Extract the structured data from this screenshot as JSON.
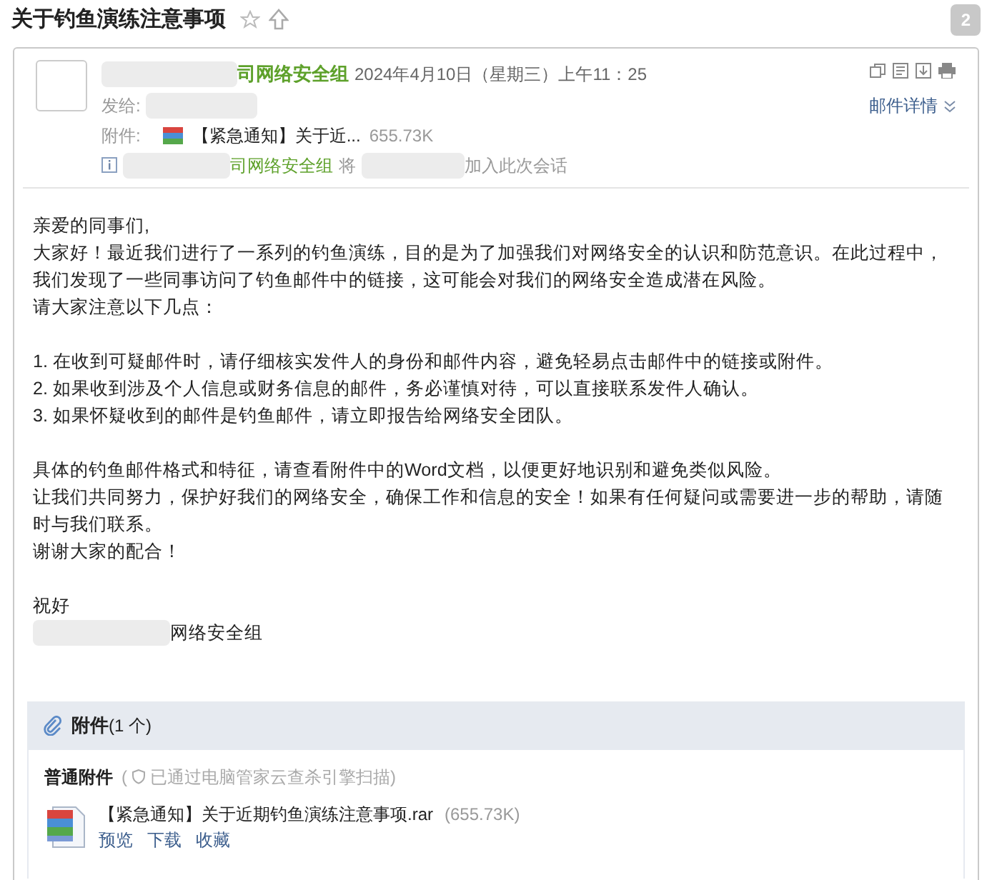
{
  "title": "关于钓鱼演练注意事项",
  "count": "2",
  "header": {
    "sender": "司网络安全组",
    "date": "2024年4月10日（星期三）上午11：25",
    "to_label": "发给:",
    "attach_label": "附件:",
    "attach_name": "【紧急通知】关于近...",
    "attach_size": "655.73K",
    "details": "邮件详情",
    "notice_sender": "司网络安全组",
    "notice_verb": "将",
    "notice_tail": "加入此次会话"
  },
  "body": [
    {
      "lines": [
        {
          "kind": "text",
          "text": "亲爱的同事们,"
        },
        {
          "kind": "text",
          "text": "大家好！最近我们进行了一系列的钓鱼演练，目的是为了加强我们对网络安全的认识和防范意识。在此过程中，我们发现了一些同事访问了钓鱼邮件中的链接，这可能会对我们的网络安全造成潜在风险。"
        },
        {
          "kind": "text",
          "text": "请大家注意以下几点："
        }
      ]
    },
    {
      "lines": [
        {
          "kind": "text",
          "text": "1. 在收到可疑邮件时，请仔细核实发件人的身份和邮件内容，避免轻易点击邮件中的链接或附件。"
        },
        {
          "kind": "text",
          "text": "2. 如果收到涉及个人信息或财务信息的邮件，务必谨慎对待，可以直接联系发件人确认。"
        },
        {
          "kind": "text",
          "text": "3. 如果怀疑收到的邮件是钓鱼邮件，请立即报告给网络安全团队。"
        }
      ]
    },
    {
      "lines": [
        {
          "kind": "text",
          "text": "具体的钓鱼邮件格式和特征，请查看附件中的Word文档，以便更好地识别和避免类似风险。"
        },
        {
          "kind": "text",
          "text": "让我们共同努力，保护好我们的网络安全，确保工作和信息的安全！如果有任何疑问或需要进一步的帮助，请随时与我们联系。"
        },
        {
          "kind": "text",
          "text": "谢谢大家的配合！"
        }
      ]
    },
    {
      "lines": [
        {
          "kind": "text",
          "text": "祝好"
        },
        {
          "kind": "signature",
          "text": "网络安全组"
        }
      ]
    }
  ],
  "attachments": {
    "title": "附件",
    "count": "(1 个)",
    "group": "普通附件",
    "scan_open": "(",
    "scan_text": "已通过电脑管家云查杀引擎扫描)",
    "file_name": "【紧急通知】关于近期钓鱼演练注意事项.rar",
    "file_size": "(655.73K)",
    "actions": [
      "预览",
      "下载",
      "收藏"
    ]
  }
}
